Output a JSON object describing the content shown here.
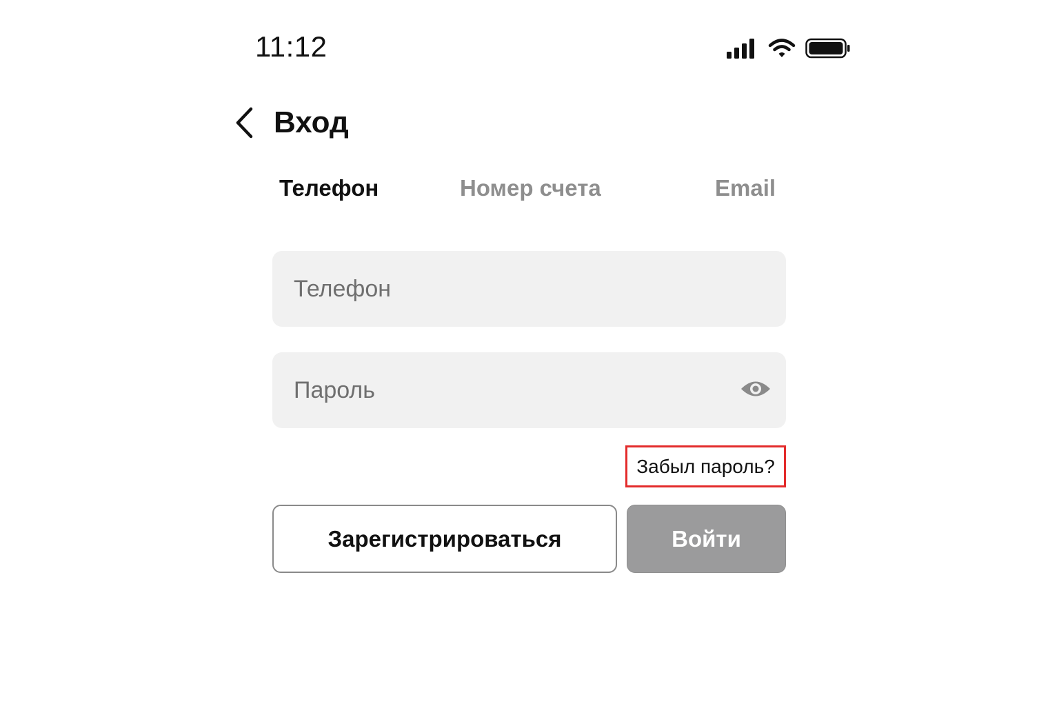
{
  "status_bar": {
    "time": "11:12",
    "icons": [
      "cellular-signal-icon",
      "wifi-icon",
      "battery-icon"
    ]
  },
  "header": {
    "back_icon": "chevron-left-icon",
    "title": "Вход"
  },
  "tabs": [
    {
      "label": "Телефон",
      "active": true
    },
    {
      "label": "Номер счета",
      "active": false
    },
    {
      "label": "Email",
      "active": false
    }
  ],
  "form": {
    "phone": {
      "placeholder": "Телефон",
      "value": ""
    },
    "password": {
      "placeholder": "Пароль",
      "value": "",
      "toggle_icon": "eye-icon"
    },
    "forgot_label": "Забыл пароль?"
  },
  "actions": {
    "register_label": "Зарегистрироваться",
    "login_label": "Войти"
  },
  "colors": {
    "field_background": "#f1f1f1",
    "inactive_tab": "#8e8e8e",
    "login_button_disabled": "#9b9b9c",
    "highlight_border": "#e32b2b"
  }
}
